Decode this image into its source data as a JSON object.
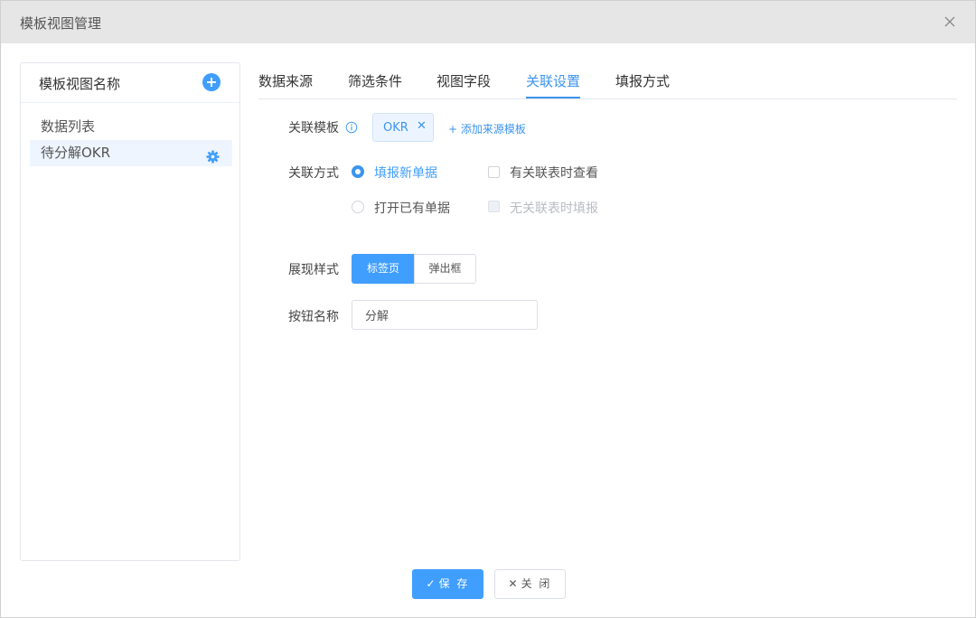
{
  "dialog": {
    "title": "模板视图管理"
  },
  "left_panel": {
    "title": "模板视图名称",
    "items": [
      {
        "label": "数据列表"
      },
      {
        "label": "待分解OKR"
      }
    ]
  },
  "tabs": [
    {
      "label": "数据来源"
    },
    {
      "label": "筛选条件"
    },
    {
      "label": "视图字段"
    },
    {
      "label": "关联设置"
    },
    {
      "label": "填报方式"
    }
  ],
  "form": {
    "link_template": {
      "label": "关联模板",
      "tag": "OKR",
      "add_link": "+ 添加来源模板"
    },
    "link_mode": {
      "label": "关联方式",
      "radio_new": "填报新单据",
      "radio_open": "打开已有单据",
      "check_view": "有关联表时查看",
      "check_fill": "无关联表时填报"
    },
    "display_style": {
      "label": "展现样式",
      "tab_page": "标签页",
      "popup": "弹出框"
    },
    "button_name": {
      "label": "按钮名称",
      "value": "分解"
    }
  },
  "footer": {
    "save": "保 存",
    "close": "关 闭"
  },
  "colors": {
    "accent": "#409eff",
    "header_bg": "#e6e6e6"
  }
}
